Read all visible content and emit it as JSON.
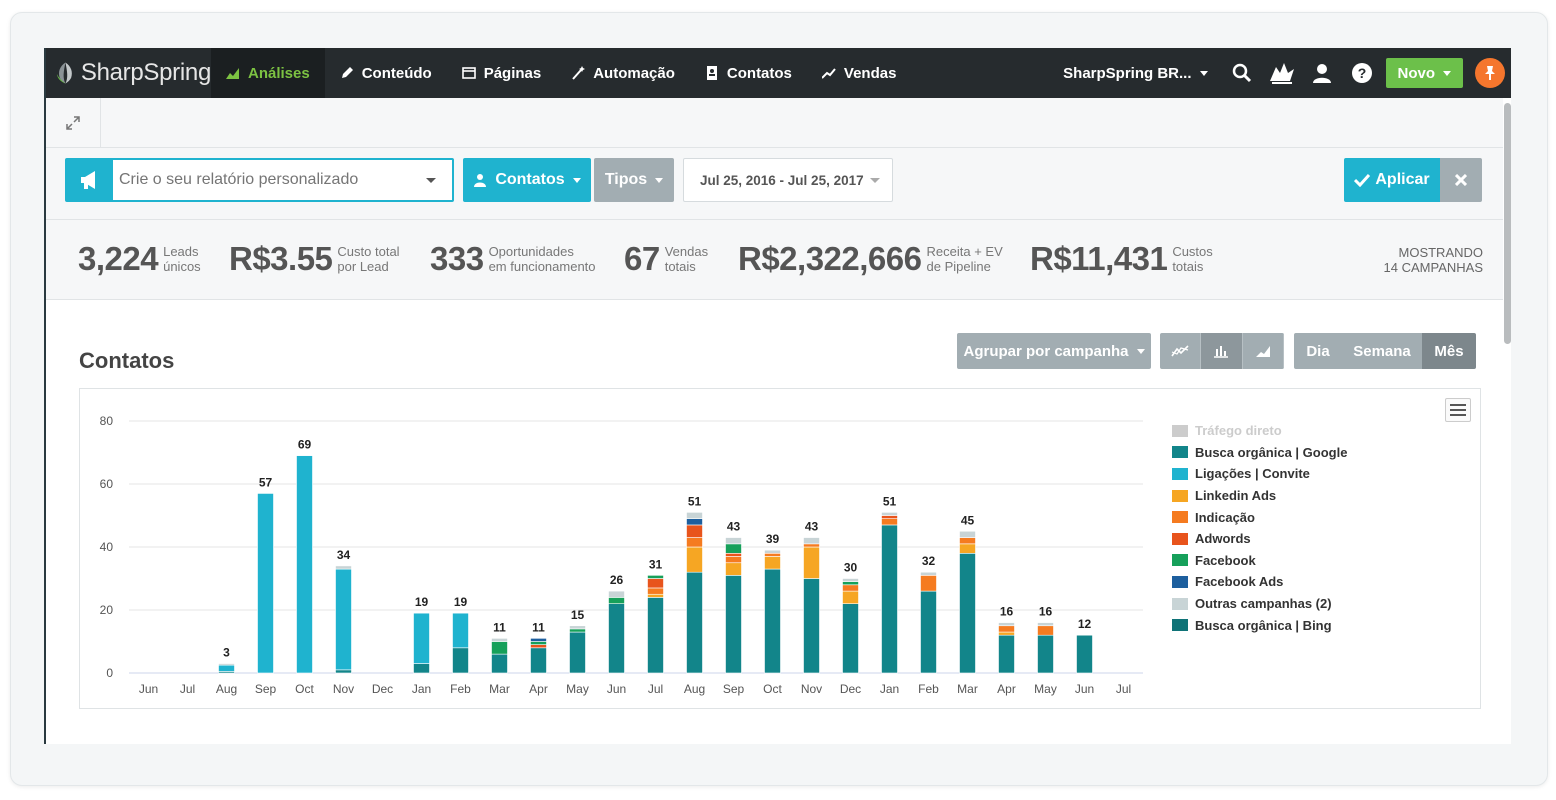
{
  "nav": {
    "logo_text": "SharpSpring",
    "items": [
      {
        "label": "Análises",
        "icon": "chart-icon",
        "active": true
      },
      {
        "label": "Conteúdo",
        "icon": "pencil-icon"
      },
      {
        "label": "Páginas",
        "icon": "window-icon"
      },
      {
        "label": "Automação",
        "icon": "wand-icon"
      },
      {
        "label": "Contatos",
        "icon": "contact-book-icon"
      },
      {
        "label": "Vendas",
        "icon": "trend-icon"
      }
    ],
    "account": "SharpSpring BR...",
    "novo_label": "Novo"
  },
  "filters": {
    "report_placeholder": "Crie o seu relatório personalizado",
    "contatos_label": "Contatos",
    "tipos_label": "Tipos",
    "date_range": "Jul 25, 2016 - Jul 25, 2017",
    "apply_label": "Aplicar"
  },
  "stats": [
    {
      "value": "3,224",
      "label1": "Leads",
      "label2": "únicos"
    },
    {
      "value": "R$3.55",
      "label1": "Custo total",
      "label2": "por Lead"
    },
    {
      "value": "333",
      "label1": "Oportunidades",
      "label2": "em funcionamento"
    },
    {
      "value": "67",
      "label1": "Vendas",
      "label2": "totais"
    },
    {
      "value": "R$2,322,666",
      "label1": "Receita + EV",
      "label2": "de Pipeline"
    },
    {
      "value": "R$11,431",
      "label1": "Custos",
      "label2": "totais"
    }
  ],
  "showing": {
    "line1": "MOSTRANDO",
    "line2": "14 CAMPANHAS"
  },
  "section": {
    "title": "Contatos",
    "group_label": "Agrupar por campanha",
    "periods": [
      "Dia",
      "Semana",
      "Mês"
    ],
    "active_period": "Mês"
  },
  "colors": {
    "accent": "#1fb3cf",
    "nav_bg": "#262b2e",
    "active_nav": "#7cc242",
    "novo": "#6cc04a",
    "pin": "#f5762d"
  },
  "chart_data": {
    "type": "bar",
    "stacked": true,
    "categories": [
      "Jun",
      "Jul",
      "Aug",
      "Sep",
      "Oct",
      "Nov",
      "Dec",
      "Jan",
      "Feb",
      "Mar",
      "Apr",
      "May",
      "Jun",
      "Jul",
      "Aug",
      "Sep",
      "Oct",
      "Nov",
      "Dec",
      "Jan",
      "Feb",
      "Mar",
      "Apr",
      "May",
      "Jun",
      "Jul"
    ],
    "totals": [
      0,
      0,
      3,
      57,
      69,
      34,
      0,
      19,
      19,
      11,
      11,
      15,
      26,
      31,
      51,
      43,
      39,
      43,
      30,
      51,
      32,
      45,
      16,
      16,
      12,
      0
    ],
    "ylim": [
      0,
      80
    ],
    "yticks": [
      0,
      20,
      40,
      60,
      80
    ],
    "grid": true,
    "legend_position": "right",
    "series": [
      {
        "name": "Tráfego direto",
        "color": "#cccccc",
        "hidden": true,
        "values": [
          0,
          0,
          0,
          0,
          0,
          0,
          0,
          0,
          0,
          0,
          0,
          0,
          0,
          0,
          0,
          0,
          0,
          0,
          0,
          0,
          0,
          0,
          0,
          0,
          0,
          0
        ]
      },
      {
        "name": "Busca orgânica | Google",
        "color": "#12858a",
        "values": [
          0,
          0,
          0.5,
          0,
          0,
          1,
          0,
          3,
          8,
          6,
          8,
          13,
          22,
          24,
          32,
          31,
          33,
          30,
          22,
          47,
          26,
          38,
          12,
          12,
          12,
          0
        ]
      },
      {
        "name": "Ligações | Convite",
        "color": "#1fb3cf",
        "values": [
          0,
          0,
          2,
          57,
          69,
          32,
          0,
          16,
          11,
          0,
          0,
          0,
          0,
          0,
          0,
          0,
          0,
          0,
          0,
          0,
          0,
          0,
          0,
          0,
          0,
          0
        ]
      },
      {
        "name": "Linkedin Ads",
        "color": "#f6a623",
        "values": [
          0,
          0,
          0,
          0,
          0,
          0,
          0,
          0,
          0,
          0,
          0,
          0,
          0,
          1,
          8,
          4,
          4,
          10,
          4,
          0,
          0,
          3,
          1,
          0,
          0,
          0
        ]
      },
      {
        "name": "Indicação",
        "color": "#f57b20",
        "values": [
          0,
          0,
          0,
          0,
          0,
          0,
          0,
          0,
          0,
          0,
          0,
          0,
          0,
          2,
          3,
          2,
          1,
          1,
          2,
          2,
          5,
          2,
          2,
          3,
          0,
          0
        ]
      },
      {
        "name": "Adwords",
        "color": "#e8541c",
        "values": [
          0,
          0,
          0,
          0,
          0,
          0,
          0,
          0,
          0,
          0,
          1,
          0,
          0,
          3,
          4,
          1,
          0,
          0,
          0,
          1,
          0,
          0,
          0,
          0,
          0,
          0
        ]
      },
      {
        "name": "Facebook",
        "color": "#16a05a",
        "values": [
          0,
          0,
          0,
          0,
          0,
          0,
          0,
          0,
          0,
          4,
          1,
          1,
          2,
          1,
          0,
          3,
          0,
          0,
          1,
          0,
          0,
          0,
          0,
          0,
          0,
          0
        ]
      },
      {
        "name": "Facebook Ads",
        "color": "#1d5f9e",
        "values": [
          0,
          0,
          0,
          0,
          0,
          0,
          0,
          0,
          0,
          0,
          1,
          0,
          0,
          0,
          2,
          0,
          0,
          0,
          0,
          0,
          0,
          0,
          0,
          0,
          0,
          0
        ]
      },
      {
        "name": "Outras campanhas (2)",
        "color": "#c8d4d6",
        "values": [
          0,
          0,
          0.5,
          0,
          0,
          1,
          0,
          0,
          0,
          1,
          0,
          1,
          2,
          0,
          2,
          2,
          1,
          2,
          1,
          1,
          1,
          2,
          1,
          1,
          0,
          0
        ]
      },
      {
        "name": "Busca orgânica | Bing",
        "color": "#0f7377",
        "values": [
          0,
          0,
          0,
          0,
          0,
          0,
          0,
          0,
          0,
          0,
          0,
          0,
          0,
          0,
          0,
          0,
          0,
          0,
          0,
          0,
          0,
          0,
          0,
          0,
          0,
          0
        ]
      }
    ]
  }
}
